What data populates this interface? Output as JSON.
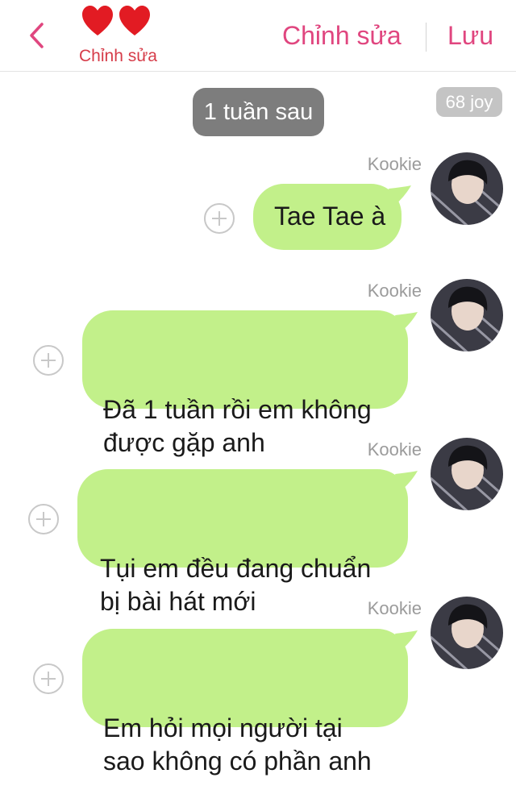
{
  "header": {
    "back_icon": "chevron-left-icon",
    "hearts_icon": "two-red-hearts-icon",
    "subtitle": "Chỉnh sửa",
    "edit_label": "Chỉnh sửa",
    "save_label": "Lưu"
  },
  "timeline": {
    "time_label": "1 tuần sau",
    "joy_badge": "68 joy"
  },
  "messages": [
    {
      "sender": "Kookie",
      "text": "Tae Tae à"
    },
    {
      "sender": "Kookie",
      "text": "Đã 1 tuần rồi em không\nđược gặp anh"
    },
    {
      "sender": "Kookie",
      "text": "Tụi em đều đang chuẩn\nbị bài hát mới"
    },
    {
      "sender": "Kookie",
      "text": "Em hỏi mọi người tại\nsao không có phần anh"
    }
  ],
  "colors": {
    "accent": "#e0467f",
    "subtitle": "#d63c49",
    "bubble": "#c2f08a",
    "pill": "#7d7d7d",
    "badge": "#c4c4c4"
  }
}
